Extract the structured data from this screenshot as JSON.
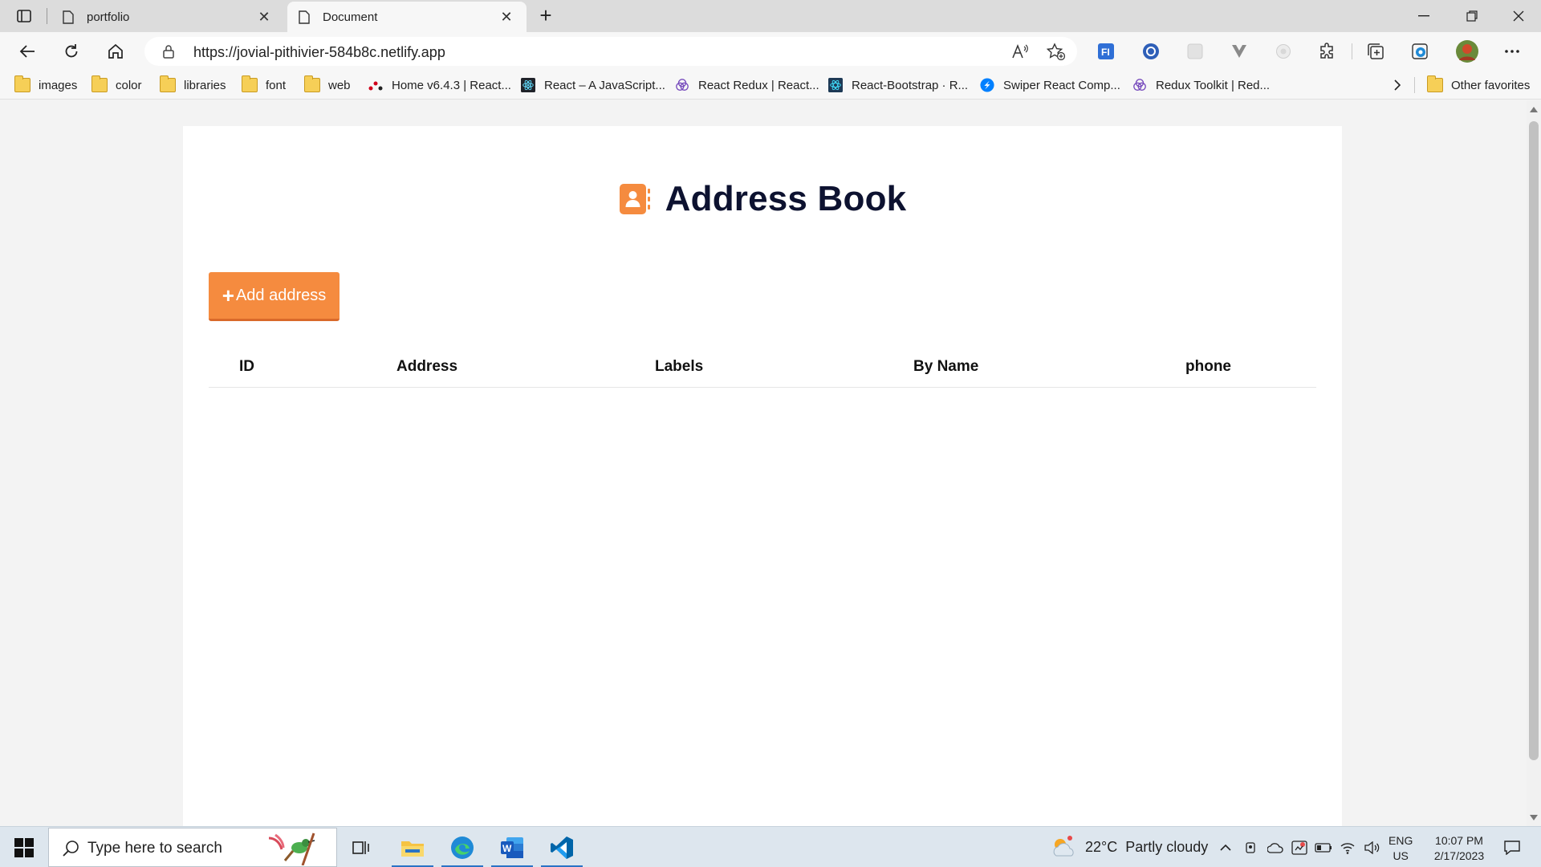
{
  "browser": {
    "tabs": [
      {
        "title": "portfolio",
        "active": false
      },
      {
        "title": "Document",
        "active": true
      }
    ],
    "url": "https://jovial-pithivier-584b8c.netlify.app",
    "favorites": [
      {
        "label": "images",
        "icon": "folder-icon"
      },
      {
        "label": "color",
        "icon": "folder-icon"
      },
      {
        "label": "libraries",
        "icon": "folder-icon"
      },
      {
        "label": "font",
        "icon": "folder-icon"
      },
      {
        "label": "web",
        "icon": "folder-icon"
      },
      {
        "label": "Home v6.4.3 | React...",
        "icon": "react-router-icon"
      },
      {
        "label": "React – A JavaScript...",
        "icon": "react-icon"
      },
      {
        "label": "React Redux | React...",
        "icon": "redux-icon"
      },
      {
        "label": "React-Bootstrap · R...",
        "icon": "react-bootstrap-icon"
      },
      {
        "label": "Swiper React Comp...",
        "icon": "swiper-icon"
      },
      {
        "label": "Redux Toolkit | Red...",
        "icon": "redux-icon"
      }
    ],
    "other_favorites": "Other favorites"
  },
  "page": {
    "title": "Address Book",
    "add_button": "Add address",
    "add_button_plus": "+",
    "columns": [
      "ID",
      "Address",
      "Labels",
      "By Name",
      "phone"
    ],
    "rows": [],
    "accent": "#f58b3f",
    "title_color": "#0d1230"
  },
  "taskbar": {
    "search_placeholder": "Type here to search",
    "weather": {
      "temp": "22°C",
      "condition": "Partly cloudy"
    },
    "lang": {
      "code": "ENG",
      "region": "US"
    },
    "time": "10:07 PM",
    "date": "2/17/2023"
  }
}
